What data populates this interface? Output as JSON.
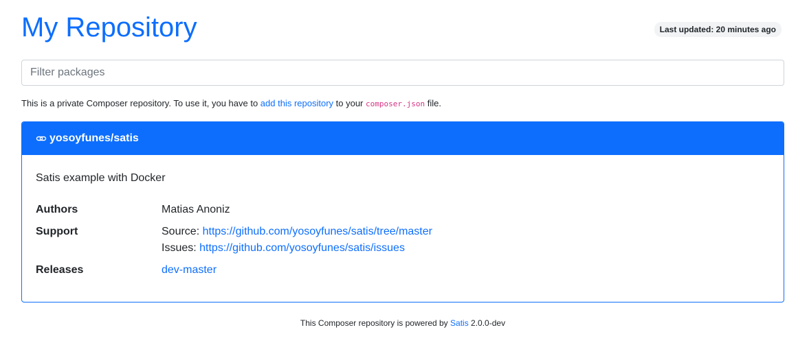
{
  "header": {
    "title": "My Repository",
    "last_updated": "Last updated: 20 minutes ago"
  },
  "filter": {
    "placeholder": "Filter packages",
    "value": ""
  },
  "intro": {
    "text_before": "This is a private Composer repository. To use it, you have to ",
    "link_label": "add this repository",
    "text_middle": " to your ",
    "code": "composer.json",
    "text_after": " file."
  },
  "package": {
    "name": "yosoyfunes/satis",
    "icon": "link-icon",
    "description": "Satis example with Docker",
    "authors_label": "Authors",
    "authors_value": "Matias Anoniz",
    "support_label": "Support",
    "support_source_prefix": "Source: ",
    "support_source_url": "https://github.com/yosoyfunes/satis/tree/master",
    "support_issues_prefix": "Issues: ",
    "support_issues_url": "https://github.com/yosoyfunes/satis/issues",
    "releases_label": "Releases",
    "releases": [
      "dev-master"
    ]
  },
  "footer": {
    "text_before": "This Composer repository is powered by ",
    "link_label": "Satis",
    "text_after": " 2.0.0-dev"
  },
  "colors": {
    "accent": "#0d6efd",
    "code": "#d63384"
  }
}
